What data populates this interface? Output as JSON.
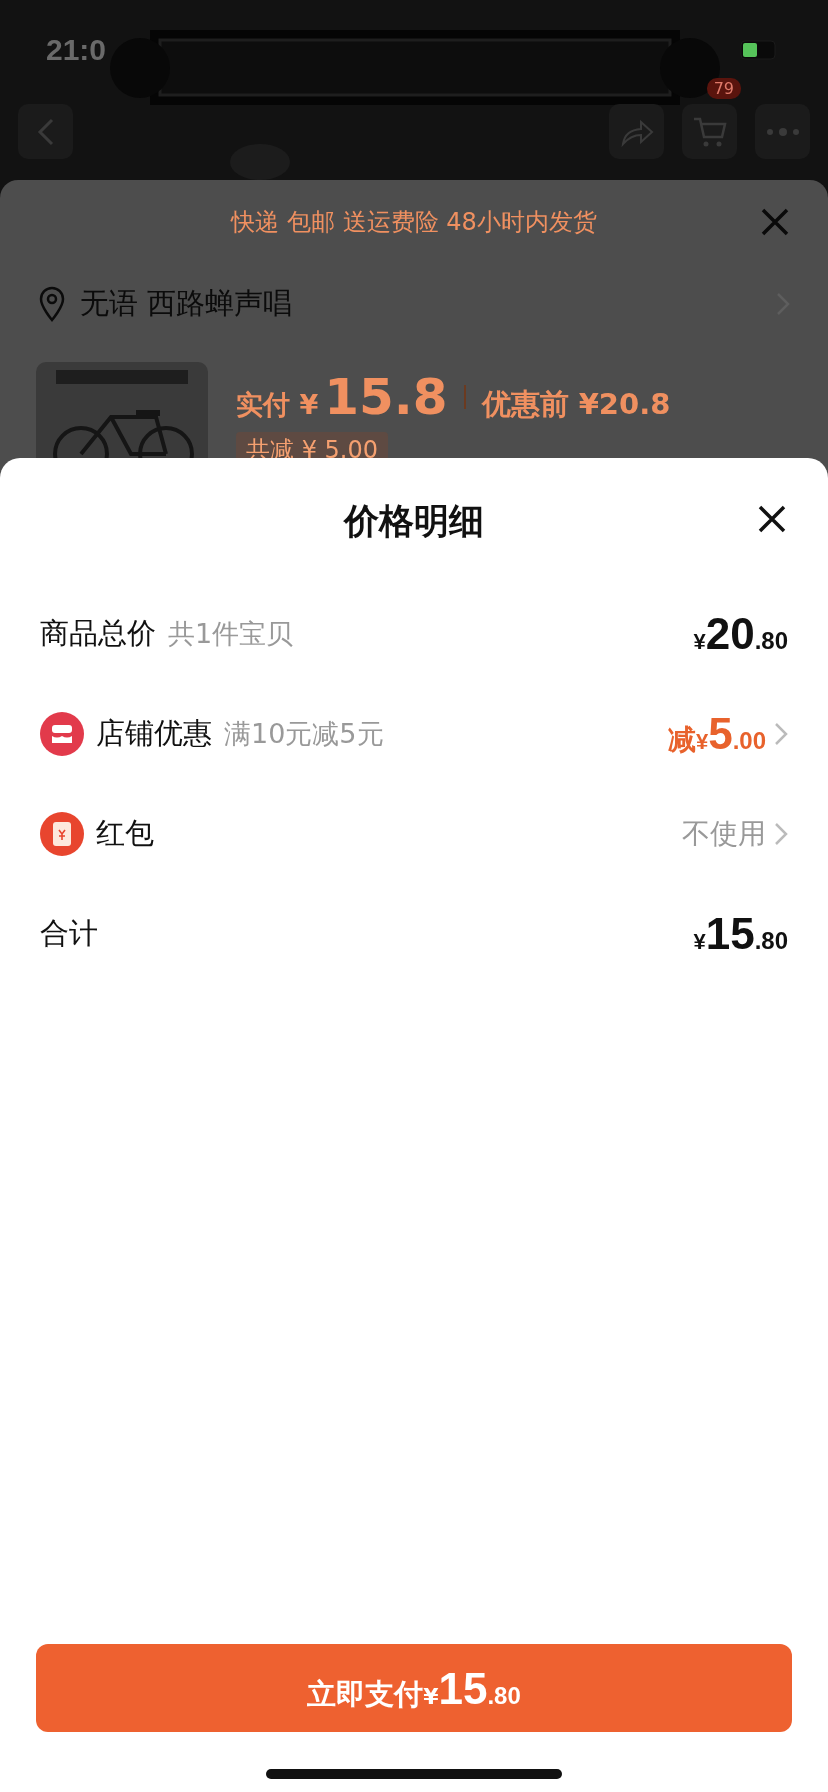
{
  "status_bar": {
    "time": "21:0"
  },
  "nav": {
    "cart_badge": "79"
  },
  "order_sheet": {
    "shipping_info": "快递 包邮 送运费险 48小时内发货",
    "address": "无语 西路蝉声唱",
    "paid_label": "实付 ¥",
    "paid_amount": "15.8",
    "original_label": "优惠前 ¥20.8",
    "discount_tag": "共减 ¥ 5.00"
  },
  "price_detail": {
    "title": "价格明细",
    "rows": [
      {
        "kind": "total",
        "label": "商品总价",
        "note": "共1件宝贝",
        "currency": "¥",
        "integer": "20",
        "decimal": ".80"
      },
      {
        "kind": "discount",
        "label": "店铺优惠",
        "note": "满10元减5元",
        "prefix": "减",
        "currency": "¥",
        "integer": "5",
        "decimal": ".00"
      },
      {
        "kind": "option",
        "label": "红包",
        "value": "不使用"
      },
      {
        "kind": "sum",
        "label": "合计",
        "currency": "¥",
        "integer": "15",
        "decimal": ".80"
      }
    ]
  },
  "pay_button": {
    "label": "立即支付",
    "currency": "¥",
    "integer": "15",
    "decimal": ".80"
  }
}
